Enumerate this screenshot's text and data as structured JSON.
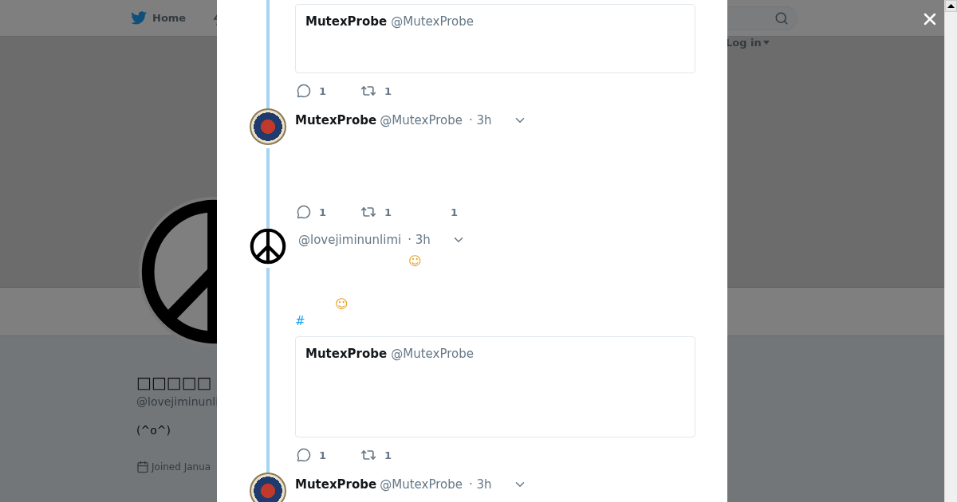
{
  "nav": {
    "home": "Home",
    "login": "Log in"
  },
  "profile": {
    "name": "□□□□□",
    "handle": "@lovejiminunli",
    "bio": "(^o^)",
    "joined": "Joined Janua"
  },
  "tweets": [
    {
      "kind": "continued",
      "quote": {
        "name": "MutexProbe",
        "handle": "@MutexProbe"
      },
      "actions": {
        "replies": "1",
        "retweets": "1"
      }
    },
    {
      "kind": "full",
      "avatar": {
        "kind": "seal"
      },
      "name": "MutexProbe",
      "handle": "@MutexProbe",
      "time": "· 3h",
      "actions": {
        "replies": "1",
        "retweets": "1",
        "likes": "1"
      }
    },
    {
      "kind": "full",
      "avatar": {
        "kind": "peace"
      },
      "handle": "@lovejiminunlimi",
      "time": "· 3h",
      "body": [
        {
          "kind": "emoji",
          "text": "☺"
        },
        {
          "kind": "emoji",
          "text": "☺"
        },
        {
          "kind": "hashtag",
          "text": "#"
        }
      ],
      "quote": {
        "name": "MutexProbe",
        "handle": "@MutexProbe"
      },
      "actions": {
        "replies": "1",
        "retweets": "1"
      }
    },
    {
      "kind": "full",
      "avatar": {
        "kind": "seal"
      },
      "name": "MutexProbe",
      "handle": "@MutexProbe",
      "time": "· 3h"
    }
  ]
}
